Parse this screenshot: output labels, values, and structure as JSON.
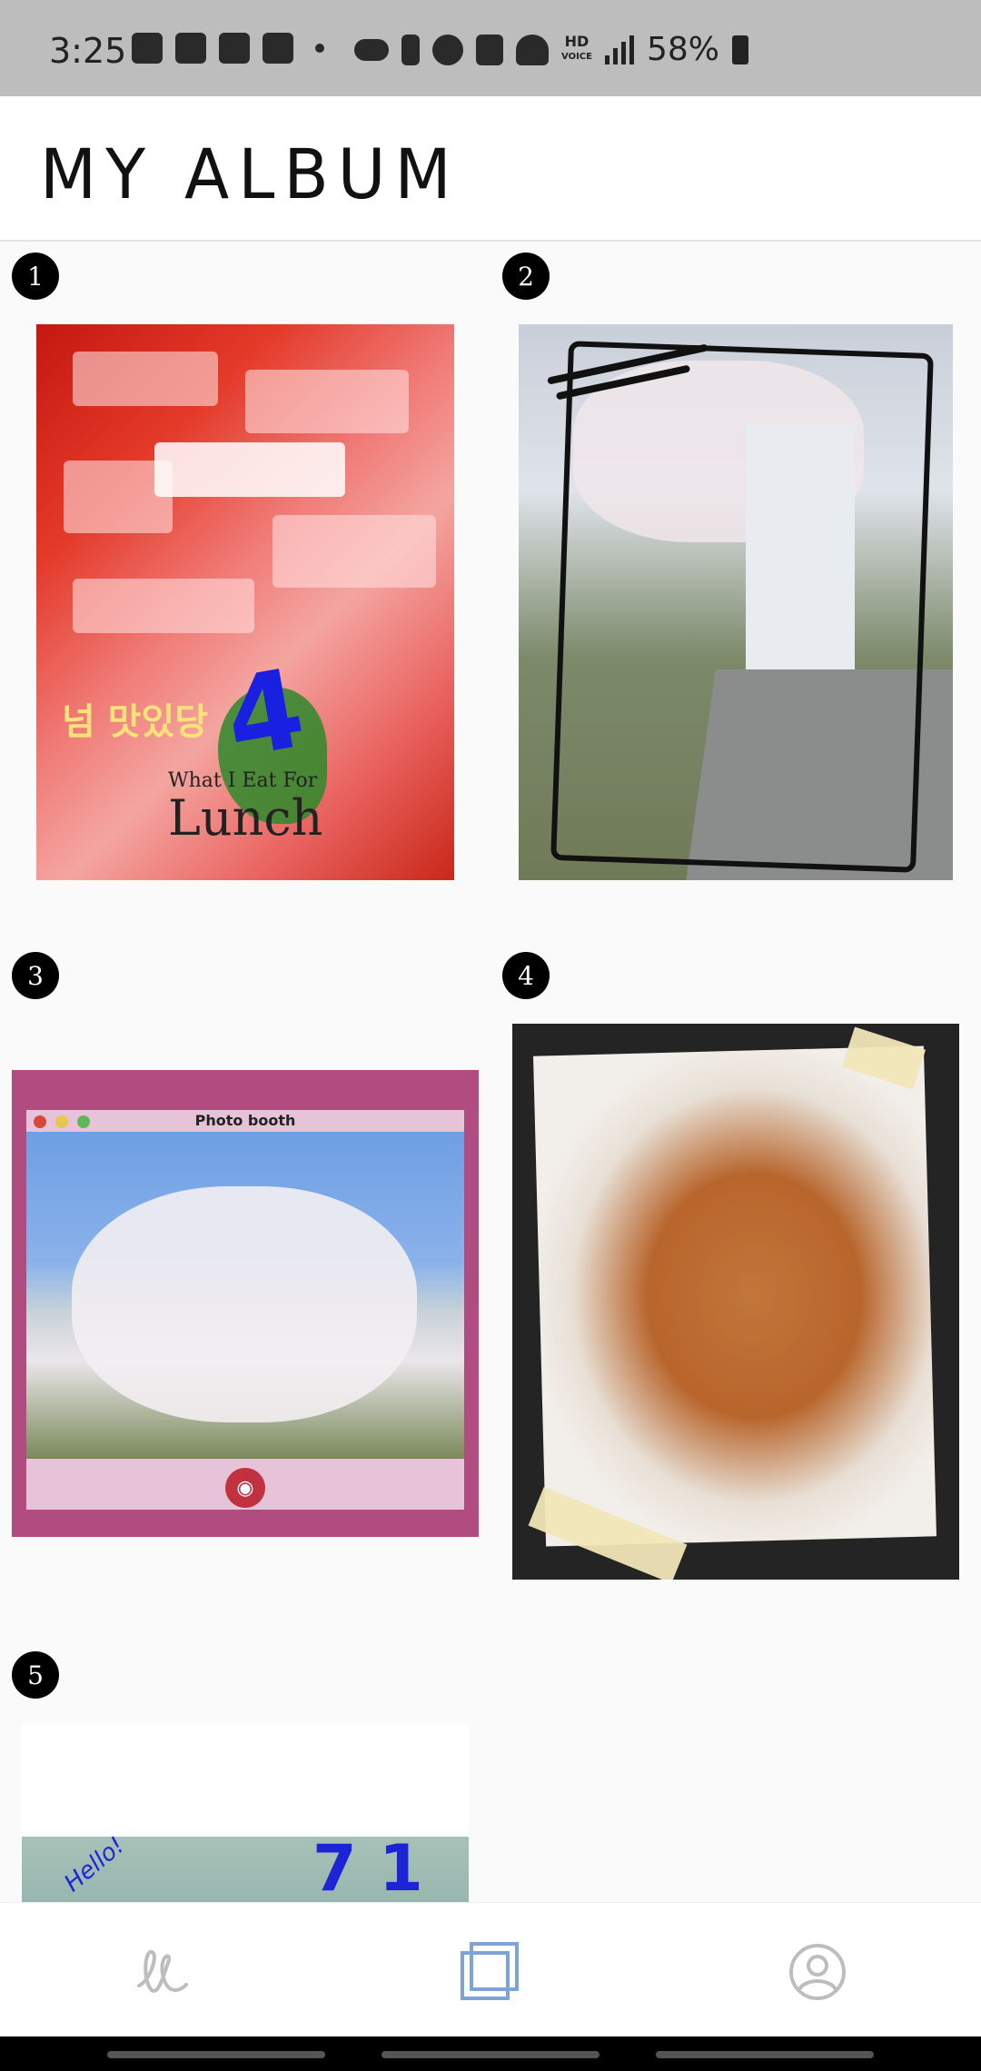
{
  "status_bar": {
    "time": "3:25",
    "network": "HD",
    "network_sub": "VOICE",
    "battery": "58%"
  },
  "app_bar": {
    "title": "MY ALBUM"
  },
  "album": {
    "items": [
      {
        "number": "1",
        "caption_korean": "넘 맛있당",
        "caption_line1": "What I Eat For",
        "caption_line2": "Lunch"
      },
      {
        "number": "2"
      },
      {
        "number": "3",
        "window_title": "Photo booth"
      },
      {
        "number": "4"
      },
      {
        "number": "5",
        "handwriting": "Hello!"
      }
    ]
  },
  "bottom_nav": {
    "items": [
      {
        "icon": "write-icon",
        "active": false
      },
      {
        "icon": "album-icon",
        "active": true
      },
      {
        "icon": "profile-icon",
        "active": false
      }
    ],
    "active_color": "#7ea3d6",
    "inactive_color": "#bdbdbd"
  }
}
